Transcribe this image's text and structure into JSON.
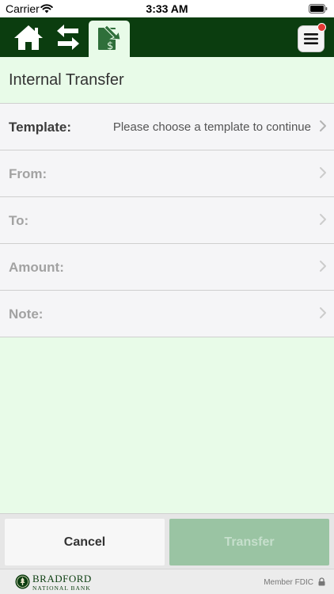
{
  "status_bar": {
    "carrier": "Carrier",
    "time": "3:33 AM",
    "icons": [
      "wifi-icon",
      "battery-icon"
    ]
  },
  "nav": {
    "items": [
      {
        "name": "home",
        "icon": "home-icon"
      },
      {
        "name": "transfers",
        "icon": "transfer-arrows-icon"
      },
      {
        "name": "internal-transfer",
        "icon": "transfer-dollar-icon",
        "active": true
      }
    ],
    "menu_icon": "hamburger-menu-icon",
    "has_notification": true
  },
  "page": {
    "title": "Internal Transfer"
  },
  "form": {
    "rows": [
      {
        "label": "Template:",
        "value": "Please choose a template to continue",
        "enabled": true
      },
      {
        "label": "From:",
        "value": "",
        "enabled": false
      },
      {
        "label": "To:",
        "value": "",
        "enabled": false
      },
      {
        "label": "Amount:",
        "value": "",
        "enabled": false
      },
      {
        "label": "Note:",
        "value": "",
        "enabled": false
      }
    ]
  },
  "actions": {
    "cancel_label": "Cancel",
    "transfer_label": "Transfer",
    "transfer_enabled": false
  },
  "footer": {
    "bank_name": "BRADFORD",
    "bank_sub": "NATIONAL BANK",
    "fdic": "Member FDIC",
    "lock_icon": "lock-icon"
  },
  "colors": {
    "brand_green": "#0b3d0f",
    "page_background": "#e8fbe8",
    "transfer_disabled": "#9ac4a3",
    "notification": "#e53935"
  }
}
